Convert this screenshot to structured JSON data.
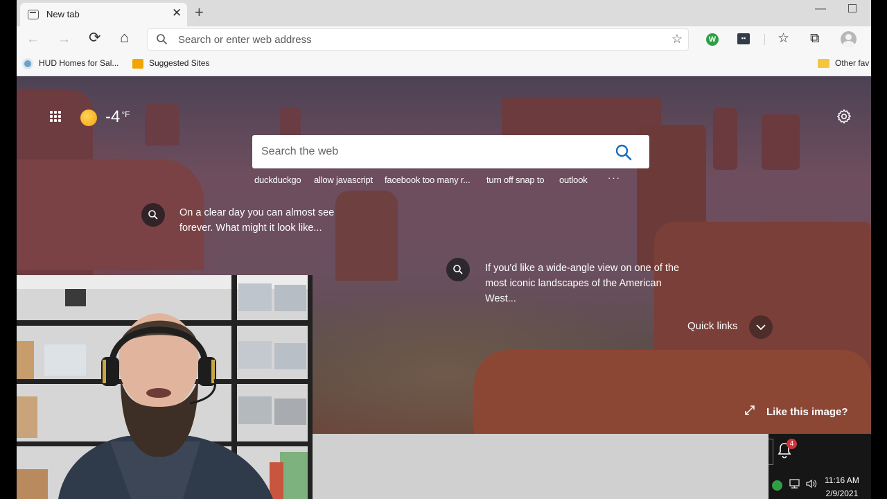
{
  "tab": {
    "title": "New tab",
    "close": "✕",
    "new": "+"
  },
  "window": {
    "minimize": "—"
  },
  "toolbar": {
    "back": "←",
    "forward": "→",
    "refresh": "⟳",
    "home": "⌂",
    "address_placeholder": "Search or enter web address",
    "add_favorite": "☆",
    "ext_w": "W",
    "ext_box": "▪▪",
    "favorites": "☆",
    "collections": "⧉"
  },
  "favorites_bar": {
    "items": [
      {
        "label": "HUD Homes for Sal...",
        "icon": "globe-icon"
      },
      {
        "label": "Suggested Sites",
        "icon": "suggested-sites-icon"
      }
    ],
    "other": "Other fav"
  },
  "ntp": {
    "weather": {
      "temp": "-4",
      "unit": "°F"
    },
    "search_placeholder": "Search the web",
    "suggestions": [
      "duckduckgo",
      "allow javascript",
      "facebook too many r...",
      "turn off snap to",
      "outlook"
    ],
    "more": "···",
    "hotspot1": "On a clear day you can almost see forever. What might it look like...",
    "hotspot2": "If you'd like a wide-angle view on one of the most iconic landscapes of the American West...",
    "quick_links": "Quick links",
    "like_image": "Like this image?"
  },
  "taskbar": {
    "notification_count": "4",
    "time": "11:16 AM",
    "date": "2/9/2021"
  }
}
